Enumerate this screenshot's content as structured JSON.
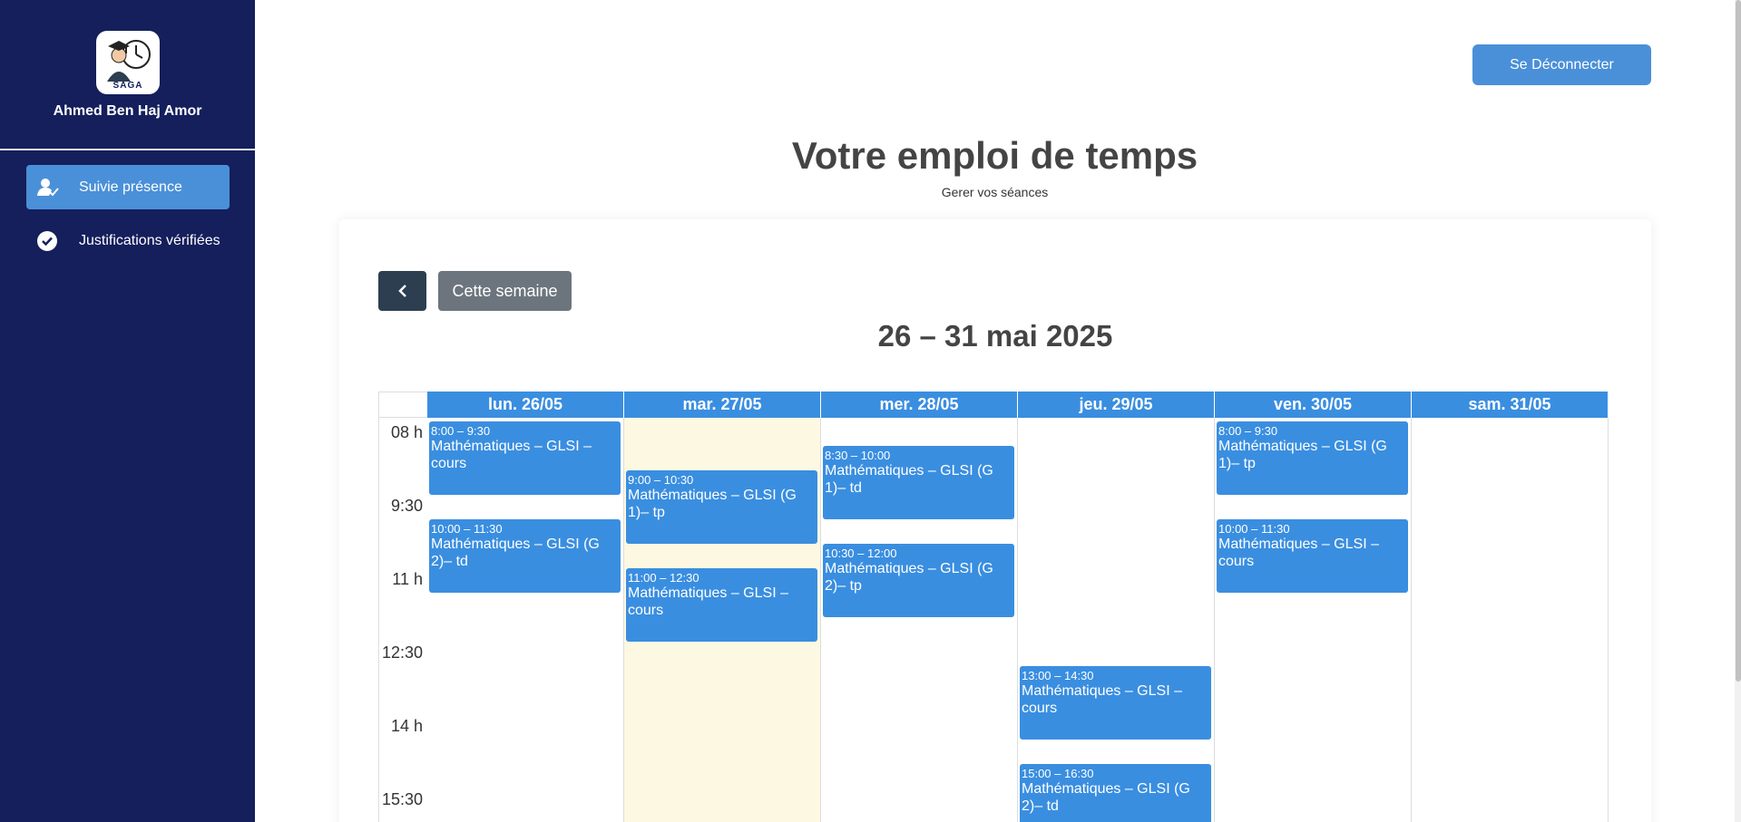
{
  "sidebar": {
    "logo_text": "SAGA",
    "username": "Ahmed Ben Haj Amor",
    "items": [
      {
        "label": "Suivie présence",
        "icon": "user-check-icon",
        "active": true
      },
      {
        "label": "Justifications vérifiées",
        "icon": "check-circle-icon",
        "active": false
      }
    ]
  },
  "header": {
    "logout_label": "Se Déconnecter",
    "title": "Votre emploi de temps",
    "subtitle": "Gerer vos séances"
  },
  "calendar": {
    "prev_icon": "chevron-left-icon",
    "this_week_label": "Cette semaine",
    "range_title": "26 – 31 mai 2025",
    "days": [
      "lun. 26/05",
      "mar. 27/05",
      "mer. 28/05",
      "jeu. 29/05",
      "ven. 30/05",
      "sam. 31/05"
    ],
    "today_index": 1,
    "time_labels": [
      "08 h",
      "9:30",
      "11 h",
      "12:30",
      "14 h",
      "15:30"
    ],
    "events": [
      {
        "day": 0,
        "time": "8:00 – 9:30",
        "title": "Mathématiques – GLSI – cours"
      },
      {
        "day": 0,
        "time": "10:00 – 11:30",
        "title": "Mathématiques – GLSI (G 2)– td"
      },
      {
        "day": 1,
        "time": "9:00 – 10:30",
        "title": "Mathématiques – GLSI (G 1)– tp"
      },
      {
        "day": 1,
        "time": "11:00 – 12:30",
        "title": "Mathématiques – GLSI – cours"
      },
      {
        "day": 2,
        "time": "8:30 – 10:00",
        "title": "Mathématiques – GLSI (G 1)– td"
      },
      {
        "day": 2,
        "time": "10:30 – 12:00",
        "title": "Mathématiques – GLSI (G 2)– tp"
      },
      {
        "day": 3,
        "time": "13:00 – 14:30",
        "title": "Mathématiques – GLSI – cours"
      },
      {
        "day": 3,
        "time": "15:00 – 16:30",
        "title": "Mathématiques – GLSI (G 2)– td"
      },
      {
        "day": 4,
        "time": "8:00 – 9:30",
        "title": "Mathématiques – GLSI (G 1)– tp"
      },
      {
        "day": 4,
        "time": "10:00 – 11:30",
        "title": "Mathématiques – GLSI – cours"
      }
    ]
  },
  "colors": {
    "sidebar_bg": "#141f5c",
    "accent": "#4a90d9",
    "event_bg": "#3a8ee0",
    "today_bg": "#fdf8e1"
  }
}
